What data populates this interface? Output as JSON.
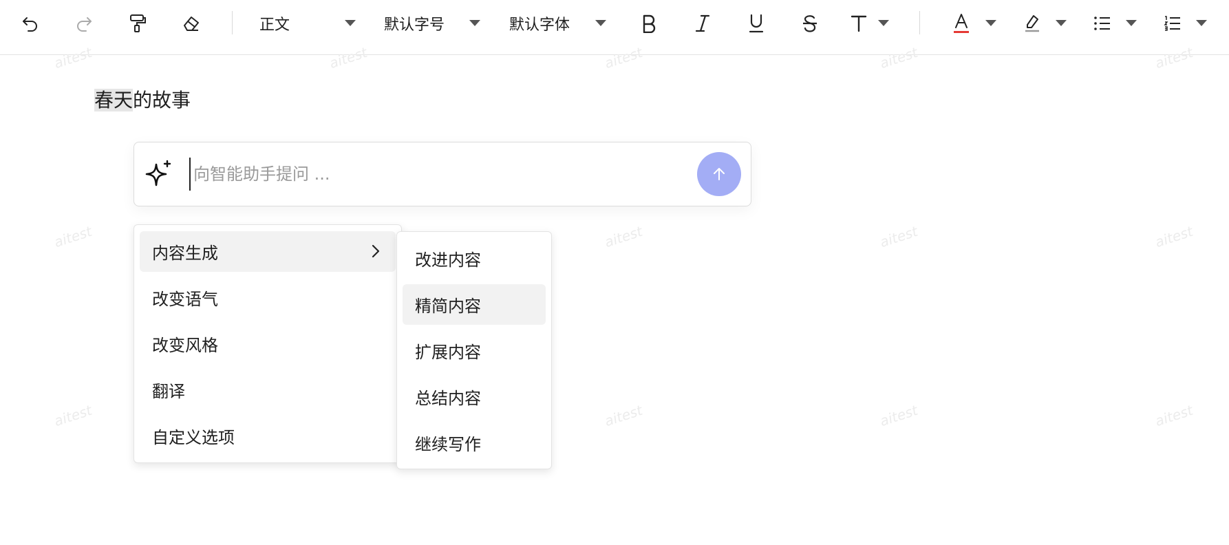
{
  "toolbar": {
    "paragraph_style": "正文",
    "font_size": "默认字号",
    "font_family": "默认字体",
    "text_color_accent": "#e53935",
    "icons": [
      "undo-icon",
      "redo-icon",
      "format-painter-icon",
      "eraser-icon",
      "bold-icon",
      "italic-icon",
      "underline-icon",
      "strikethrough-icon",
      "text-style-icon",
      "font-color-icon",
      "highlight-icon",
      "bullet-list-icon",
      "numbered-list-icon"
    ]
  },
  "watermark": "aitest",
  "document": {
    "title_highlighted": "春天",
    "title_rest": "的故事"
  },
  "assistant": {
    "placeholder": "向智能助手提问 ...",
    "value": "",
    "send_color": "#a3adf5"
  },
  "menu": {
    "items": [
      {
        "label": "内容生成",
        "has_submenu": true
      },
      {
        "label": "改变语气"
      },
      {
        "label": "改变风格"
      },
      {
        "label": "翻译"
      },
      {
        "label": "自定义选项"
      }
    ],
    "submenu": [
      {
        "label": "改进内容"
      },
      {
        "label": "精简内容"
      },
      {
        "label": "扩展内容"
      },
      {
        "label": "总结内容"
      },
      {
        "label": "继续写作"
      }
    ]
  }
}
